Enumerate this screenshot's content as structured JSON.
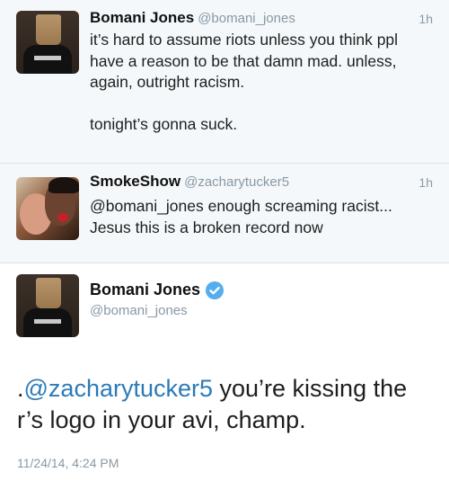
{
  "tweets": [
    {
      "name": "Bomani Jones",
      "handle": "@bomani_jones",
      "time": "1h",
      "text": "it’s hard to assume riots unless you think ppl have a reason to be that damn mad. unless, again, outright racism.\n\ntonight’s gonna suck."
    },
    {
      "name": "SmokeShow",
      "handle": "@zacharytucker5",
      "time": "1h",
      "text": "@bomani_jones enough screaming racist... Jesus this is a broken record now"
    }
  ],
  "main": {
    "name": "Bomani Jones",
    "handle": "@bomani_jones",
    "verified_icon": "verified-badge-icon",
    "text_prefix": ".",
    "mention": "@zacharytucker5",
    "text_rest": " you’re kissing the r’s logo in your avi, champ.",
    "timestamp": "11/24/14, 4:24 PM"
  },
  "colors": {
    "link": "#2b7bb9",
    "muted": "#8899a6",
    "verified": "#55acee"
  }
}
